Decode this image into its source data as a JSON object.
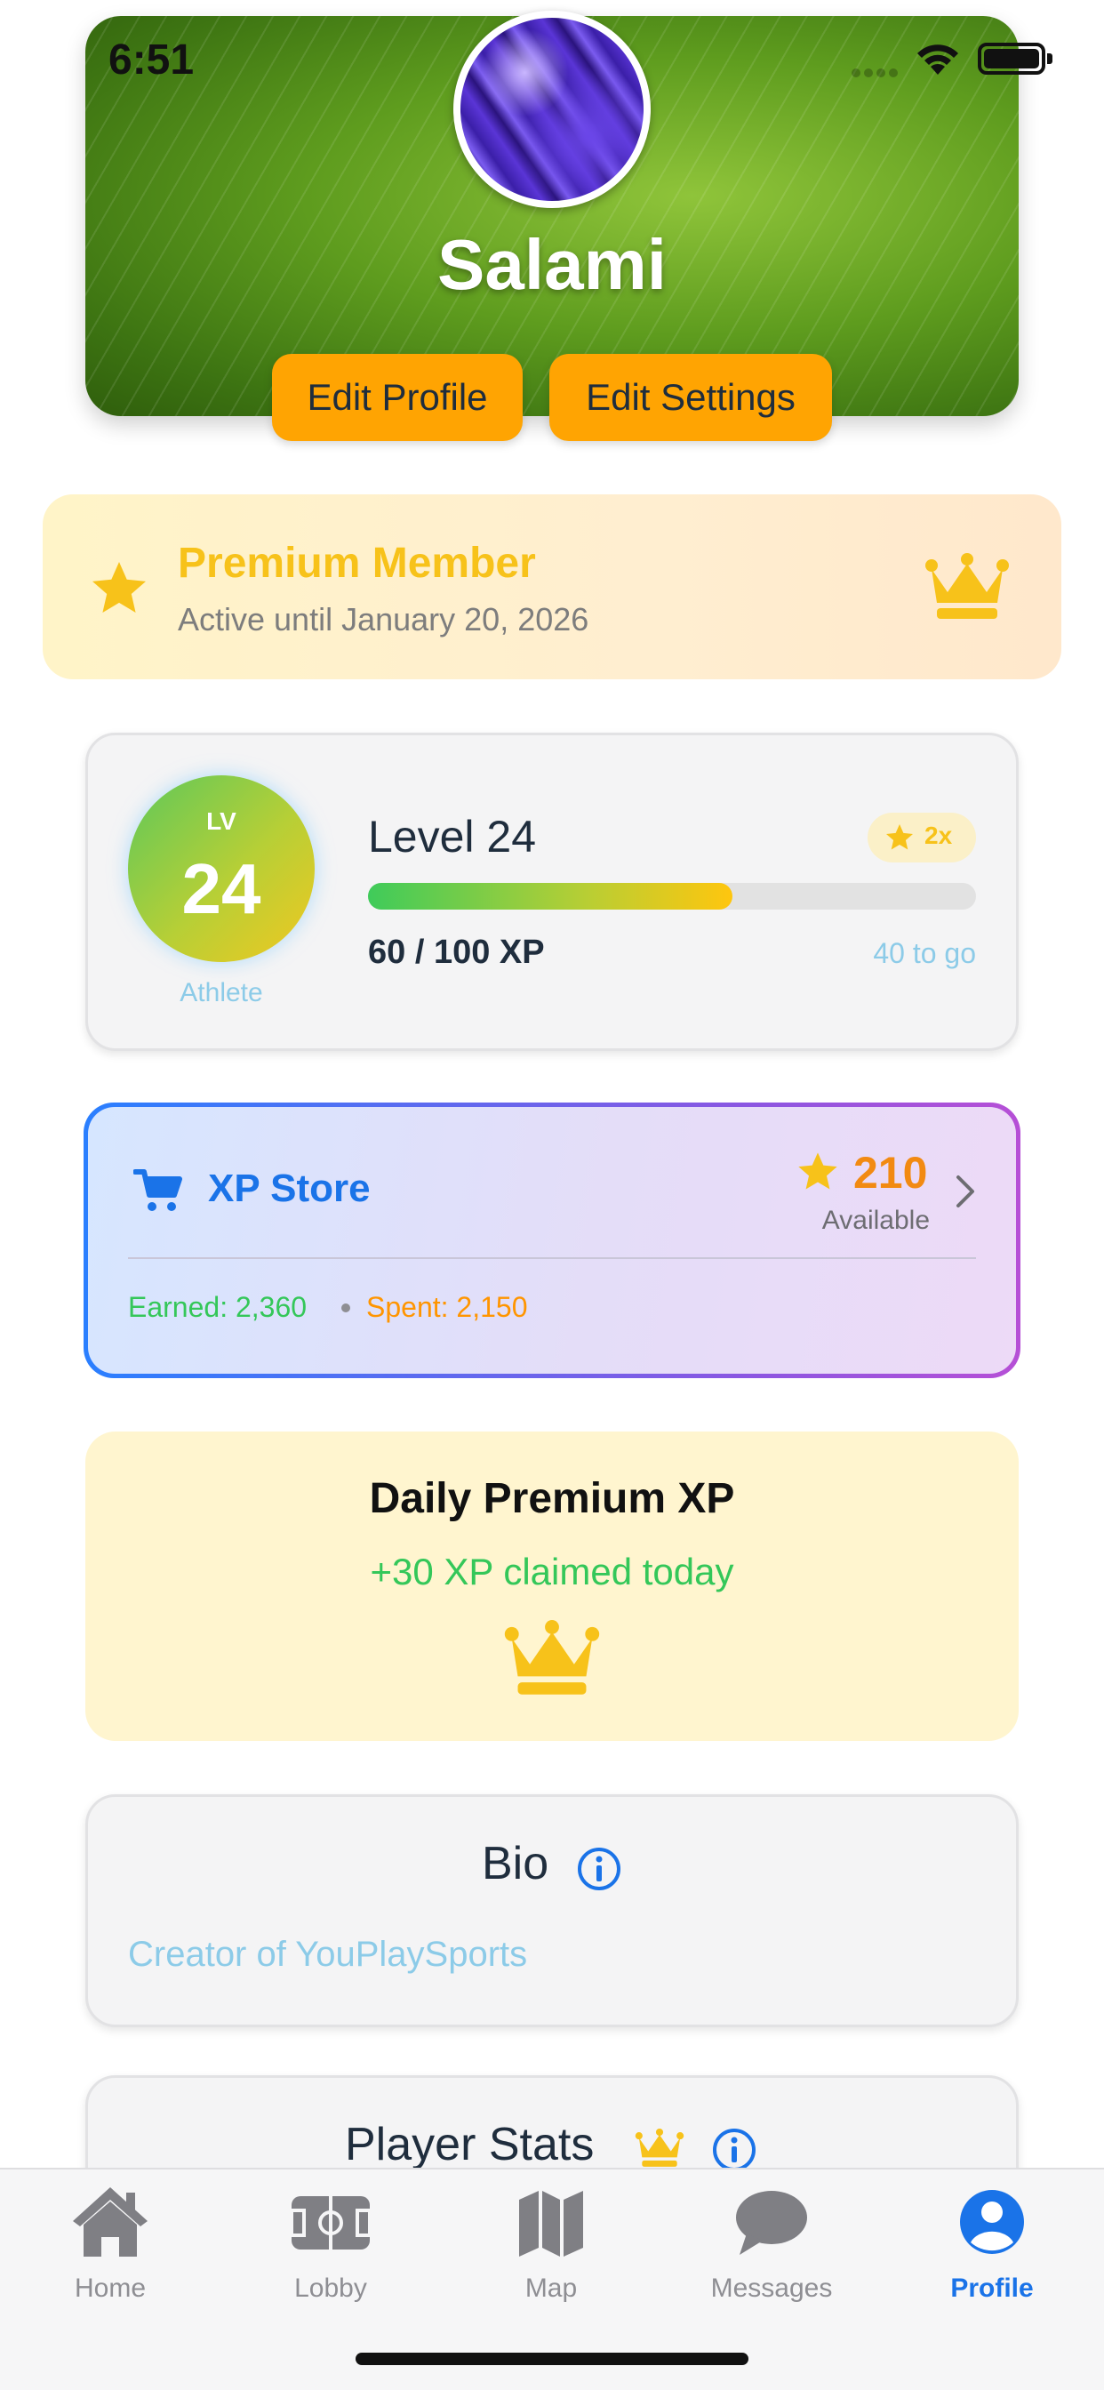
{
  "status_bar": {
    "time": "6:51"
  },
  "profile": {
    "name": "Salami",
    "edit_profile_label": "Edit Profile",
    "edit_settings_label": "Edit Settings"
  },
  "premium": {
    "title": "Premium Member",
    "subtitle": "Active until January 20, 2026",
    "icons": [
      "star-icon",
      "crown-icon"
    ]
  },
  "level": {
    "badge_label": "LV",
    "badge_number": "24",
    "rank": "Athlete",
    "title": "Level 24",
    "boost": "2x",
    "xp_text": "60 / 100 XP",
    "xp_progress": 0.6,
    "to_go": "40 to go"
  },
  "xp_store": {
    "title": "XP Store",
    "points": "210",
    "available_label": "Available",
    "earned": "Earned: 2,360",
    "spent": "Spent: 2,150"
  },
  "daily": {
    "title": "Daily Premium XP",
    "subtitle": "+30 XP claimed today"
  },
  "bio": {
    "title": "Bio",
    "text": "Creator of YouPlaySports"
  },
  "player_stats": {
    "title": "Player Stats"
  },
  "tabs": [
    {
      "label": "Home",
      "icon": "home-icon",
      "active": false
    },
    {
      "label": "Lobby",
      "icon": "field-icon",
      "active": false
    },
    {
      "label": "Map",
      "icon": "map-icon",
      "active": false
    },
    {
      "label": "Messages",
      "icon": "chat-bubble-icon",
      "active": false
    },
    {
      "label": "Profile",
      "icon": "person-circle-icon",
      "active": true
    }
  ],
  "colors": {
    "accent": "#1a73e8",
    "button_orange": "#ffa402",
    "gold": "#f7c21a",
    "green": "#34c759",
    "orange": "#ff9500"
  }
}
